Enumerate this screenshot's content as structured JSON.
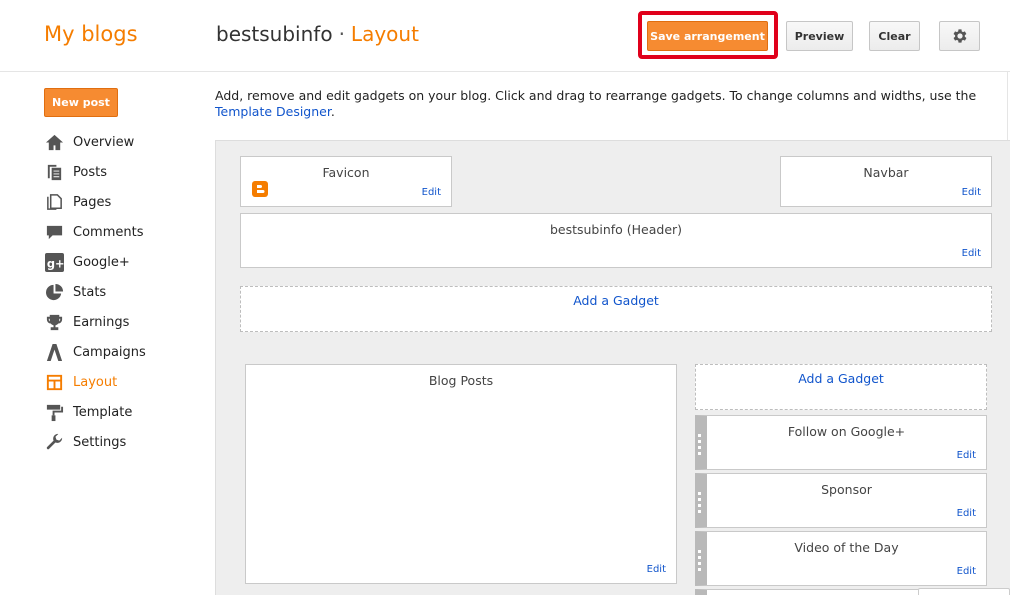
{
  "header": {
    "brand": "My blogs",
    "blog_name": "bestsubinfo",
    "separator": "·",
    "page": "Layout",
    "buttons": {
      "save": "Save arrangement",
      "preview": "Preview",
      "clear": "Clear"
    },
    "highlight_color": "#e0001b"
  },
  "sidebar": {
    "new_post": "New post",
    "items": [
      {
        "label": "Overview",
        "icon": "home-icon"
      },
      {
        "label": "Posts",
        "icon": "posts-icon"
      },
      {
        "label": "Pages",
        "icon": "pages-icon"
      },
      {
        "label": "Comments",
        "icon": "comment-icon"
      },
      {
        "label": "Google+",
        "icon": "google-plus-icon"
      },
      {
        "label": "Stats",
        "icon": "pie-chart-icon"
      },
      {
        "label": "Earnings",
        "icon": "trophy-icon"
      },
      {
        "label": "Campaigns",
        "icon": "adwords-icon"
      },
      {
        "label": "Layout",
        "icon": "layout-icon",
        "active": true
      },
      {
        "label": "Template",
        "icon": "paint-roller-icon"
      },
      {
        "label": "Settings",
        "icon": "wrench-icon"
      }
    ]
  },
  "main": {
    "intro_text": "Add, remove and edit gadgets on your blog. Click and drag to rearrange gadgets. To change columns and widths, use the",
    "intro_link": "Template Designer",
    "intro_end": ".",
    "edit_label": "Edit",
    "add_gadget_label": "Add a Gadget",
    "gadgets": {
      "favicon": "Favicon",
      "navbar": "Navbar",
      "header": "bestsubinfo (Header)",
      "blog_posts": "Blog Posts",
      "follow": "Follow on Google+",
      "sponsor": "Sponsor",
      "video": "Video of the Day"
    }
  },
  "colors": {
    "accent": "#f57d00",
    "button_orange": "#f68b31",
    "link": "#1155cc",
    "canvas_bg": "#eeeeee"
  }
}
